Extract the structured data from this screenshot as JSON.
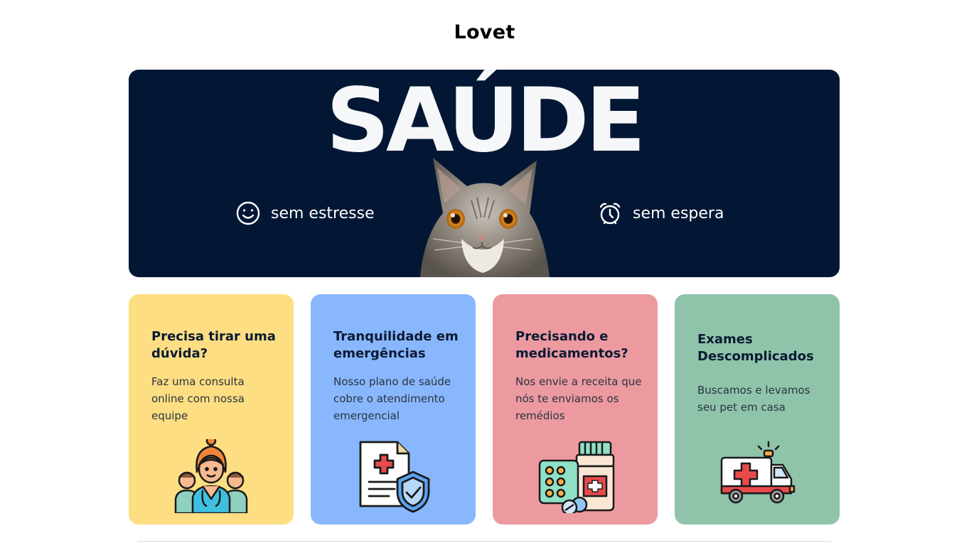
{
  "header": {
    "brand": "Lovet"
  },
  "hero": {
    "title": "SAÚDE",
    "features": [
      {
        "label": "sem estresse",
        "icon": "smiley-icon"
      },
      {
        "label": "sem espera",
        "icon": "alarm-clock-icon"
      }
    ],
    "image": "cat-photo",
    "background": "#031735"
  },
  "cards": [
    {
      "title": "Precisa tirar uma dúvida?",
      "text": "Faz uma consulta online com nossa equipe",
      "color": "#fdde82",
      "icon": "medical-team-icon"
    },
    {
      "title": "Tranquilidade em emergências",
      "text": "Nosso plano de saúde cobre o atendimento emergencial",
      "color": "#89b7fd",
      "icon": "insurance-document-icon"
    },
    {
      "title": "Precisando e medicamentos?",
      "text": "Nos envie a receita que nós te enviamos os remédios",
      "color": "#ec9aa0",
      "icon": "medicines-icon"
    },
    {
      "title": "Exames Descomplicados",
      "text": "Buscamos e levamos seu pet em casa",
      "color": "#8fc4aa",
      "icon": "ambulance-icon"
    }
  ]
}
